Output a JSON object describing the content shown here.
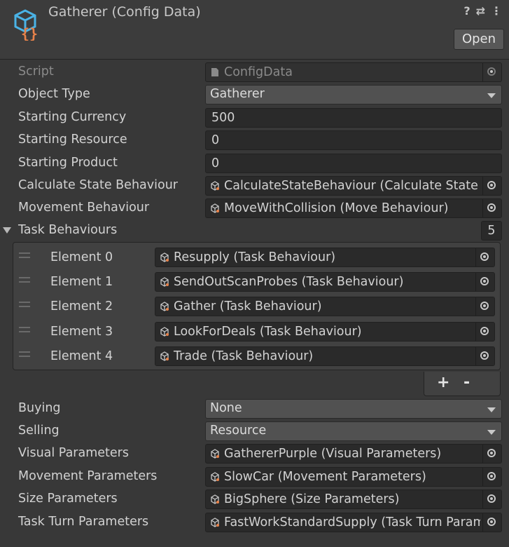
{
  "header": {
    "title": "Gatherer (Config Data)",
    "open_label": "Open",
    "help_icon": "?",
    "settings_icon": "⇄",
    "more_icon": "⋮"
  },
  "fields": {
    "script": {
      "label": "Script",
      "value": "ConfigData"
    },
    "object_type": {
      "label": "Object Type",
      "value": "Gatherer"
    },
    "starting_currency": {
      "label": "Starting Currency",
      "value": "500"
    },
    "starting_resource": {
      "label": "Starting Resource",
      "value": "0"
    },
    "starting_product": {
      "label": "Starting Product",
      "value": "0"
    },
    "calculate_state": {
      "label": "Calculate State Behaviour",
      "value": "CalculateStateBehaviour (Calculate State Behaviour)"
    },
    "movement_behaviour": {
      "label": "Movement Behaviour",
      "value": "MoveWithCollision (Move Behaviour)"
    }
  },
  "task_behaviours": {
    "label": "Task Behaviours",
    "count": "5",
    "items": [
      {
        "label": "Element 0",
        "value": "Resupply (Task Behaviour)"
      },
      {
        "label": "Element 1",
        "value": "SendOutScanProbes (Task Behaviour)"
      },
      {
        "label": "Element 2",
        "value": "Gather (Task Behaviour)"
      },
      {
        "label": "Element 3",
        "value": "LookForDeals (Task Behaviour)"
      },
      {
        "label": "Element 4",
        "value": "Trade (Task Behaviour)"
      }
    ],
    "add_label": "+",
    "remove_label": "-"
  },
  "lower": {
    "buying": {
      "label": "Buying",
      "value": "None"
    },
    "selling": {
      "label": "Selling",
      "value": "Resource"
    },
    "visual": {
      "label": "Visual Parameters",
      "value": "GathererPurple (Visual Parameters)"
    },
    "movement": {
      "label": "Movement Parameters",
      "value": "SlowCar (Movement Parameters)"
    },
    "size": {
      "label": "Size Parameters",
      "value": "BigSphere (Size Parameters)"
    },
    "task_turn": {
      "label": "Task Turn Parameters",
      "value": "FastWorkStandardSupply (Task Turn Parameters)"
    }
  },
  "colors": {
    "background": "#383838",
    "field": "#2a2a2a",
    "dropdown": "#515151",
    "icon_blue": "#4ab3e6",
    "icon_orange": "#e8824a"
  }
}
